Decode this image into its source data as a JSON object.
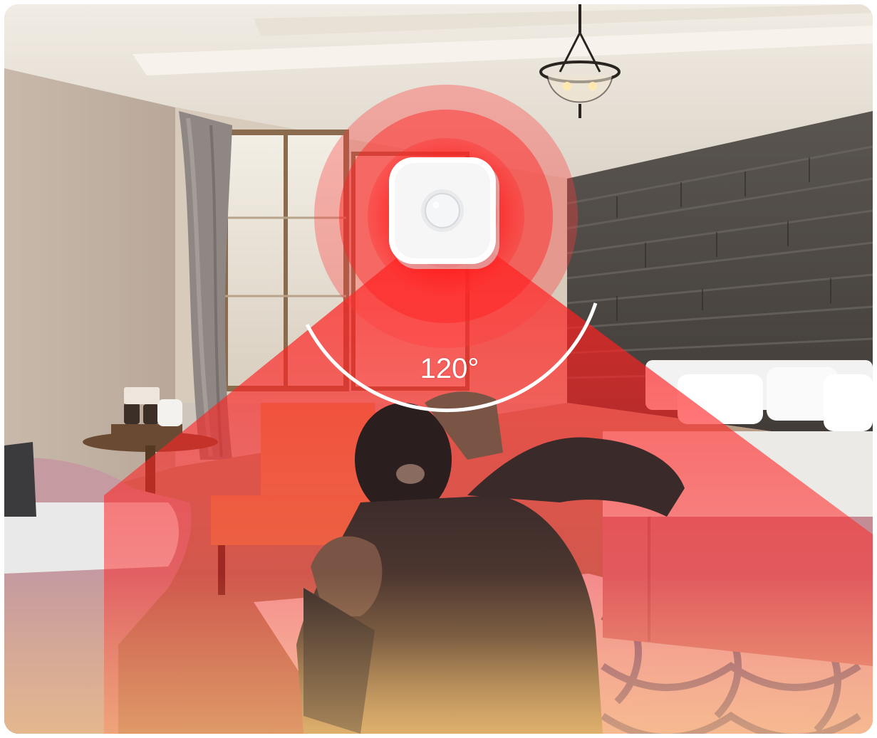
{
  "sensor": {
    "detection_angle_label": "120°",
    "icon": "pir-motion-sensor"
  },
  "colors": {
    "detection_field": "#ff1a1a",
    "sensor_body": "#ffffff",
    "frame_background": "#ffffff"
  }
}
